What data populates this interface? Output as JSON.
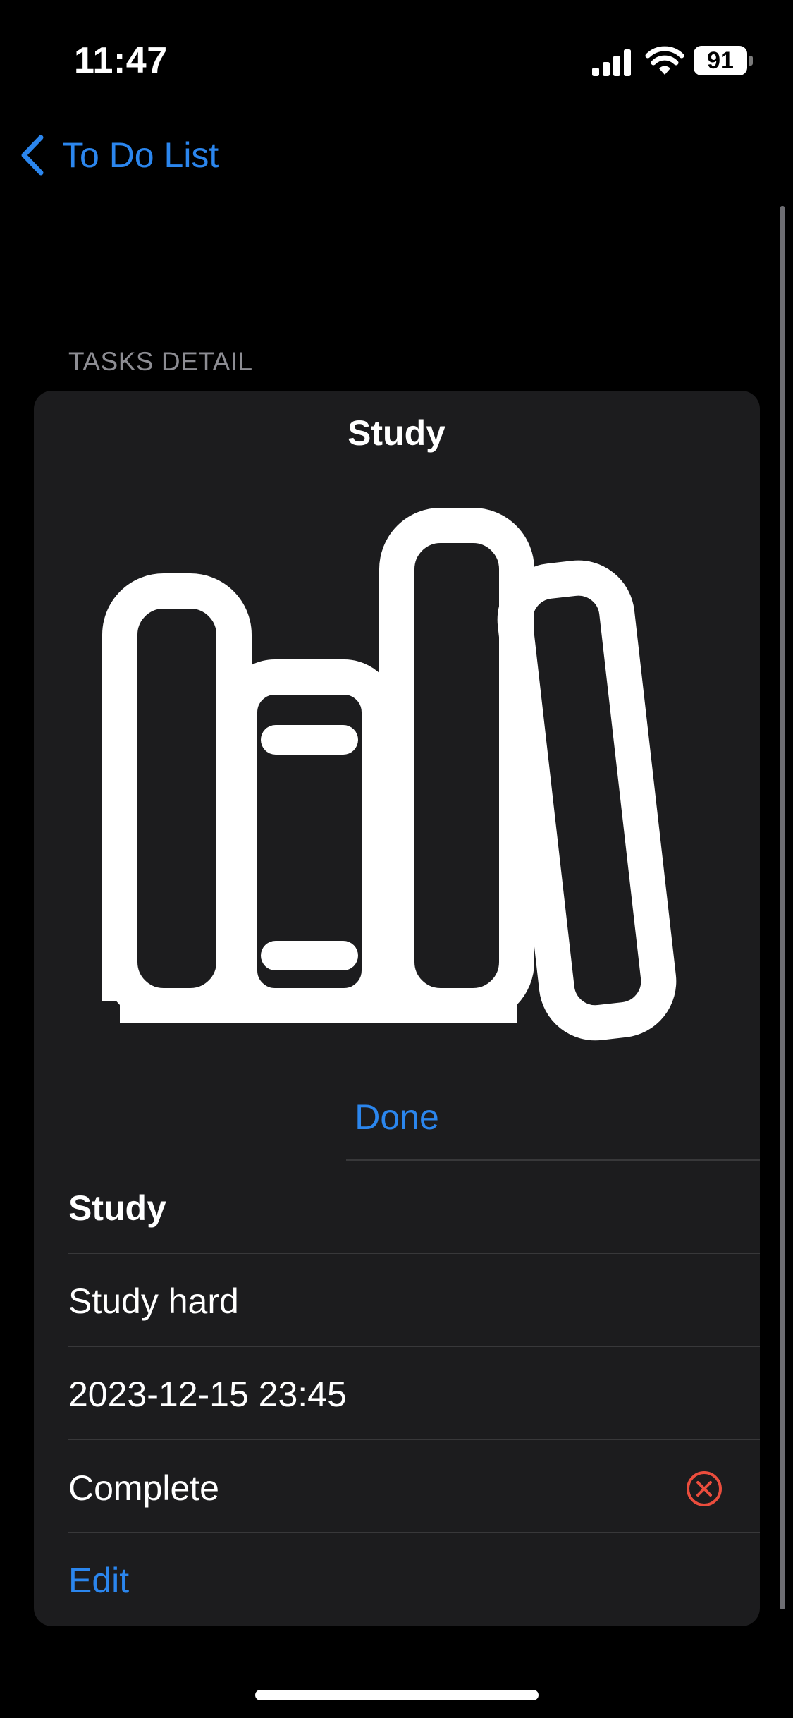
{
  "status_bar": {
    "time": "11:47",
    "battery_level": "91",
    "icons": [
      "signal-icon",
      "wifi-icon",
      "battery-icon"
    ]
  },
  "nav": {
    "back_label": "To Do List",
    "back_icon": "chevron-left-icon"
  },
  "section": {
    "header": "TASKS DETAIL"
  },
  "task": {
    "image_title": "Study",
    "image_icon": "books-icon",
    "done_label": "Done",
    "name": "Study",
    "description": "Study hard",
    "due": "2023-12-15 23:45",
    "status_label": "Complete",
    "status_icon": "x-circle-icon",
    "edit_label": "Edit"
  },
  "colors": {
    "accent": "#2b86ee",
    "background": "#000000",
    "card": "#1c1c1e",
    "destructive": "#eb4d3d",
    "secondary_text": "#8d8d93"
  }
}
